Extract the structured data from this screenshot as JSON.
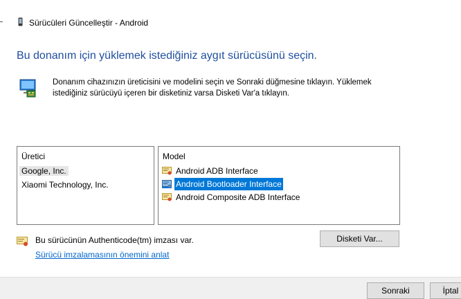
{
  "window": {
    "title": "Sürücüleri Güncelleştir - Android"
  },
  "heading": "Bu donanım için yüklemek istediğiniz aygıt sürücüsünü seçin.",
  "description": [
    "Donanım cihazınızın üreticisini ve modelini seçin ve Sonraki düğmesine tıklayın. Yüklemek",
    "istediğiniz sürücüyü içeren bir disketiniz varsa Disketi Var'a tıklayın."
  ],
  "manufacturer": {
    "header": "Üretici",
    "items": [
      "Google, Inc.",
      "Xiaomi Technology, Inc."
    ],
    "selected_index": 0
  },
  "model": {
    "header": "Model",
    "items": [
      "Android ADB Interface",
      "Android Bootloader Interface",
      "Android Composite ADB Interface"
    ],
    "selected_index": 1
  },
  "auth": {
    "text": "Bu sürücünün Authenticode(tm) imzası var.",
    "link": "Sürücü imzalamasının önemini anlat"
  },
  "buttons": {
    "have_disk": "Disketi Var...",
    "next": "Sonraki",
    "cancel": "İptal"
  },
  "icons": {
    "title": "device-icon",
    "hardware": "hardware-monitor-icon",
    "driver": "certificate-driver-icon"
  },
  "colors": {
    "heading": "#1f4e9e",
    "selection": "#0078d7",
    "link": "#0066cc"
  }
}
